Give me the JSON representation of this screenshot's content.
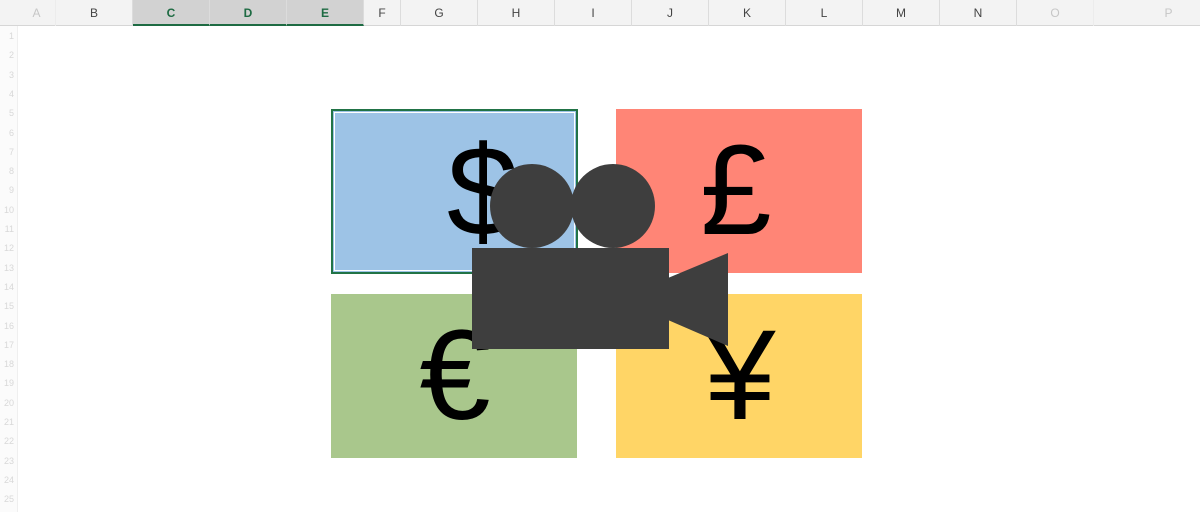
{
  "columns": [
    "A",
    "B",
    "C",
    "D",
    "E",
    "F",
    "G",
    "H",
    "I",
    "J",
    "K",
    "L",
    "M",
    "N",
    "O",
    "P"
  ],
  "selected_columns": [
    "C",
    "D",
    "E"
  ],
  "faded_columns": [
    "A",
    "O",
    "P"
  ],
  "rows": [
    "1",
    "2",
    "3",
    "4",
    "5",
    "6",
    "7",
    "8",
    "9",
    "10",
    "11",
    "12",
    "13",
    "14",
    "15",
    "16",
    "17",
    "18",
    "19",
    "20",
    "21",
    "22",
    "23",
    "24",
    "25"
  ],
  "tiles": [
    {
      "symbol": "$",
      "color": "#9dc3e6",
      "selected": true
    },
    {
      "symbol": "£",
      "color": "#ff8576"
    },
    {
      "symbol": "€",
      "color": "#a9c78c"
    },
    {
      "symbol": "¥",
      "color": "#ffd566"
    }
  ],
  "camera": {
    "icon": "video-camera-icon",
    "color": "#3e3e3e"
  },
  "colors": {
    "selection": "#217346",
    "header_bg": "#f3f3f3"
  }
}
